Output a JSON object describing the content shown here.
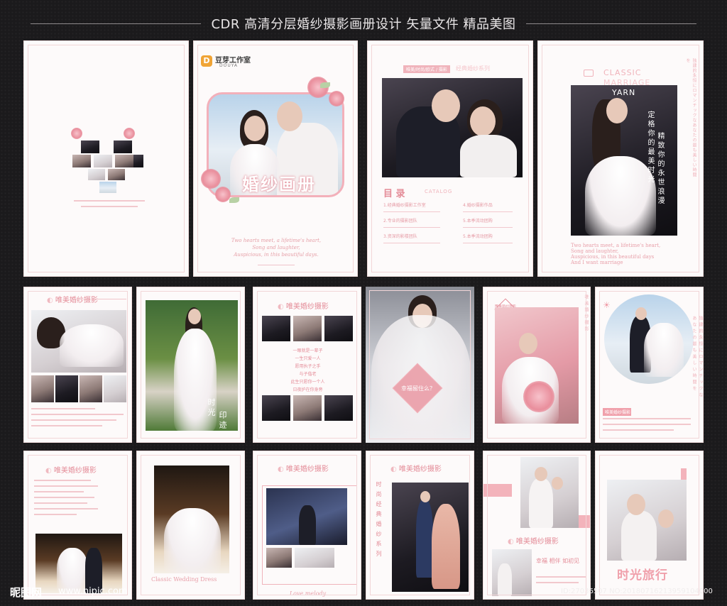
{
  "header": {
    "title": "CDR 高清分层婚纱摄影画册设计 矢量文件 精品美图"
  },
  "cover": {
    "brand": "豆芽工作室",
    "brand_sub": "DOUYA",
    "logo_letter": "D",
    "title": "婚纱画册",
    "script1": "Two hearts meet, a lifetime's heart,",
    "script2": "Song and laughter,",
    "script3": "Auspicious, in this beautiful days."
  },
  "contents": {
    "tag": "唯美/时尚/欧式 / 摄影",
    "series": "经典婚纱系列",
    "title": "目 录",
    "catalog": "CATALOG",
    "items": [
      "1.经典婚纱摄影工作室",
      "2.专业的摄影团队",
      "3.资深的影楼团队",
      "4.婚纱摄影作品",
      "5.本季流动团购",
      "5.本季流动团购"
    ]
  },
  "classic": {
    "title1": "CLASSIC",
    "title2": "MARRIAGE",
    "title3": "YARN",
    "slogan1": "定格你的最美时光",
    "slogan2": "精致你的永世浪漫",
    "vert_jp": "独建的永恒にロマンチックなあなたの最も美しい時間を",
    "script1": "Two hearts meet, a lifetime's heart,",
    "script2": "Song and laughter,",
    "script3": "Auspicious, in this beautiful days",
    "script4": "And I want marriage"
  },
  "section_title": "唯美婚纱摄影",
  "page_phrase1": "时光",
  "page_phrase2": "印迹",
  "veil_text": "幸福留住么？",
  "flower_badge": "唯美婚纱摄影",
  "poem": [
    "一眼就是一辈子",
    "一生只爱一人",
    "愿用执子之手",
    "与子偕老",
    "此生只愿你一个人",
    "日夜护在你身旁"
  ],
  "classic_wedding_dress": "Classic Wedding Dress",
  "love_melody": "Love melody",
  "fashion_series": "时尚经典婚纱系列",
  "happy": "幸福 相伴 如初见",
  "time_travel": "时光旅行",
  "watermark": {
    "brand": "昵图网",
    "url": "www.nipic.com",
    "id": "ID:27036507 NO:20180716213959104000"
  }
}
